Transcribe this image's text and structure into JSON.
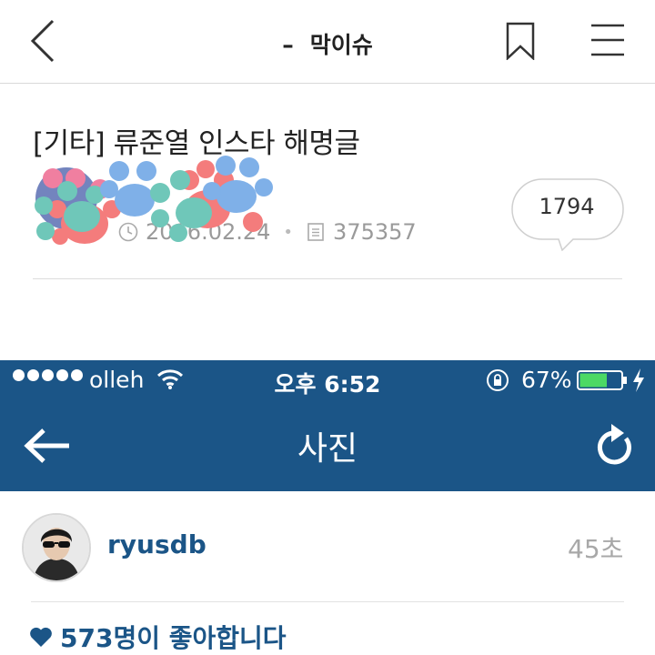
{
  "topbar": {
    "dash": "–",
    "board_name": "막이슈"
  },
  "article": {
    "title": "[기타] 류준열 인스타 해명글",
    "date": "2016.02.24",
    "views": "375357",
    "comment_count": "1794"
  },
  "screenshot": {
    "status_bar": {
      "carrier": "olleh",
      "time": "오후 6:52",
      "battery_percent": "67%",
      "battery_level": 0.67
    },
    "nav": {
      "title": "사진"
    },
    "post": {
      "username": "ryusdb",
      "time_ago": "45초",
      "likes": "573명이 좋아합니다"
    }
  },
  "colors": {
    "ig_blue": "#1b5587",
    "battery_green": "#4cd964",
    "meta_gray": "#9a9a9a"
  },
  "icons": [
    "back-chevron-icon",
    "bookmark-icon",
    "hamburger-menu-icon",
    "clock-icon",
    "document-icon",
    "wifi-icon",
    "rotation-lock-icon",
    "battery-icon",
    "charging-bolt-icon",
    "back-arrow-icon",
    "refresh-icon",
    "heart-icon"
  ]
}
